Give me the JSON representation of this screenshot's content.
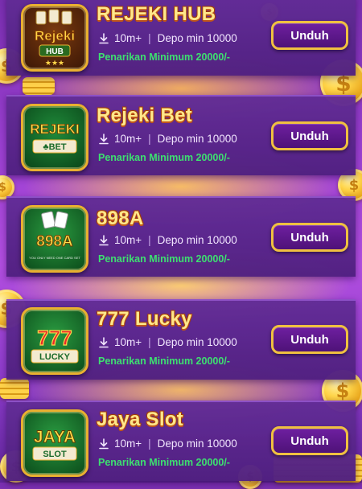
{
  "apps": [
    {
      "name": "REJEKI HUB",
      "downloads": "10m+",
      "deposit": "Depo min 10000",
      "withdraw": "Penarikan Minimum 20000/-",
      "button": "Unduh",
      "logo": {
        "line1": "Rejeki",
        "line2": "HUB",
        "extra": "★★★"
      }
    },
    {
      "name": "Rejeki Bet",
      "downloads": "10m+",
      "deposit": "Depo min 10000",
      "withdraw": "Penarikan Minimum 20000/-",
      "button": "Unduh",
      "logo": {
        "line1": "REJEKI",
        "line2": "♣BET"
      }
    },
    {
      "name": "898A",
      "downloads": "10m+",
      "deposit": "Depo min 10000",
      "withdraw": "Penarikan Minimum 20000/-",
      "button": "Unduh",
      "logo": {
        "line1": "898A",
        "line2": "YOU ONLY NEED ONE CARD SET"
      }
    },
    {
      "name": "777 Lucky",
      "downloads": "10m+",
      "deposit": "Depo min 10000",
      "withdraw": "Penarikan Minimum 20000/-",
      "button": "Unduh",
      "logo": {
        "line1": "777",
        "line2": "LUCKY"
      }
    },
    {
      "name": "Jaya Slot",
      "downloads": "10m+",
      "deposit": "Depo min 10000",
      "withdraw": "Penarikan Minimum 20000/-",
      "button": "Unduh",
      "logo": {
        "line1": "JAYA",
        "line2": "SLOT"
      }
    }
  ],
  "icons": {
    "download": "download-icon",
    "coin": "coin-icon"
  },
  "colors": {
    "accent_gold": "#f0c040",
    "withdraw_green": "#3de070",
    "card_purple": "#622c96",
    "button_purple": "#5e1890"
  }
}
